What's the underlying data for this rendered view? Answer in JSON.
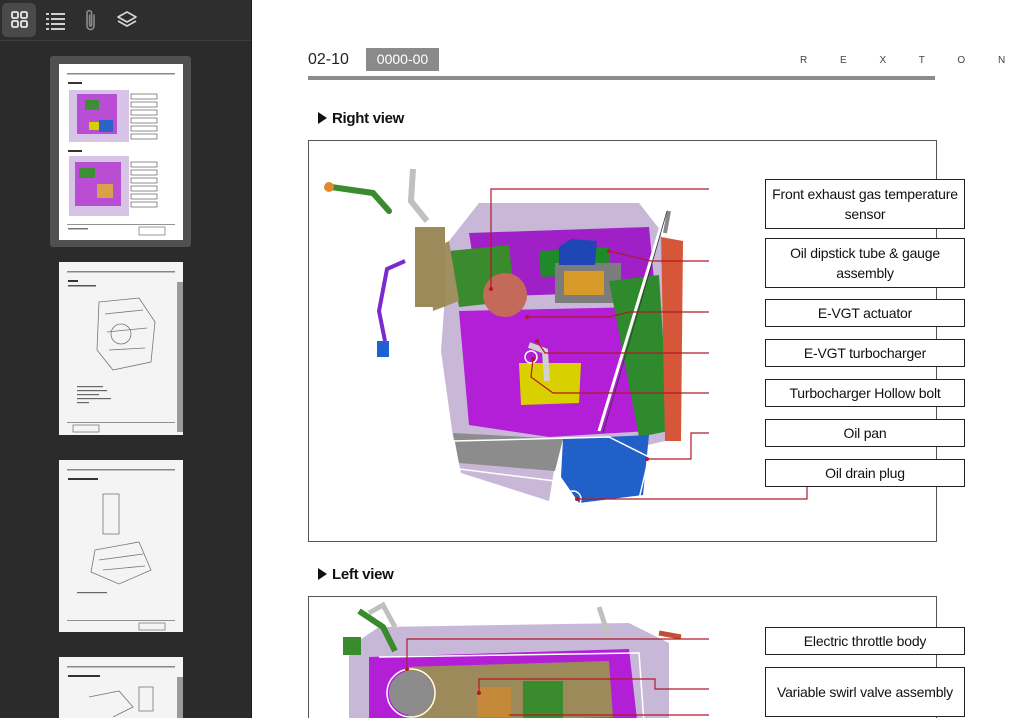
{
  "sidebar": {
    "toolbar": [
      {
        "name": "thumbnails-view-button",
        "icon": "grid-icon"
      },
      {
        "name": "outline-view-button",
        "icon": "list-icon"
      },
      {
        "name": "attachments-view-button",
        "icon": "paperclip-icon"
      },
      {
        "name": "layers-view-button",
        "icon": "layers-icon"
      }
    ],
    "active_tab": "thumbnails"
  },
  "page": {
    "header": {
      "page_number": "02-10",
      "section_code": "0000-00",
      "brand": "REXTON"
    },
    "sections": [
      {
        "title": "Right view",
        "callouts": [
          "Front exhaust gas temperature sensor",
          "Oil dipstick tube & gauge assembly",
          "E-VGT actuator",
          "E-VGT turbocharger",
          "Turbocharger Hollow bolt",
          "Oil pan",
          "Oil drain plug"
        ]
      },
      {
        "title": "Left view",
        "callouts": [
          "Electric throttle body",
          "Variable swirl valve assembly"
        ]
      }
    ]
  },
  "colors": {
    "leader_line": "#b01a2a",
    "sidebar_bg": "#2b2b2b",
    "header_code_bg": "#8a8a8a"
  }
}
